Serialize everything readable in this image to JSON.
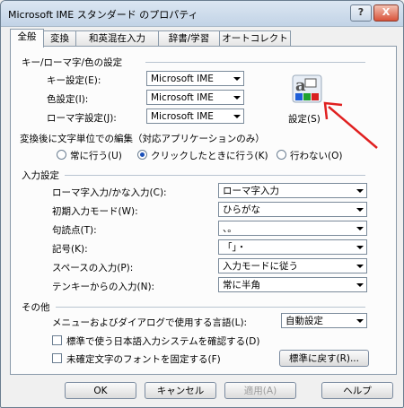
{
  "window": {
    "title": "Microsoft IME スタンダード のプロパティ",
    "help_glyph": "?",
    "close_glyph": "X"
  },
  "tabs": [
    "全般",
    "変換",
    "和英混在入力",
    "辞書/学習",
    "オートコレクト"
  ],
  "section_key": {
    "header": "キー/ローマ字/色の設定",
    "rows": [
      {
        "label": "キー設定(E):",
        "value": "Microsoft IME"
      },
      {
        "label": "色設定(I):",
        "value": "Microsoft IME"
      },
      {
        "label": "ローマ字設定(J):",
        "value": "Microsoft IME"
      }
    ],
    "settings_button": "設定(S)"
  },
  "section_conversion": {
    "header": "変換後に文字単位での編集（対応アプリケーションのみ）",
    "options": [
      {
        "label": "常に行う(U)",
        "selected": false
      },
      {
        "label": "クリックしたときに行う(K)",
        "selected": true
      },
      {
        "label": "行わない(O)",
        "selected": false
      }
    ]
  },
  "section_input": {
    "header": "入力設定",
    "rows": [
      {
        "label": "ローマ字入力/かな入力(C):",
        "value": "ローマ字入力"
      },
      {
        "label": "初期入力モード(W):",
        "value": "ひらがな"
      },
      {
        "label": "句読点(T):",
        "value": "、。"
      },
      {
        "label": "記号(K):",
        "value": "「」・"
      },
      {
        "label": "スペースの入力(P):",
        "value": "入力モードに従う"
      },
      {
        "label": "テンキーからの入力(N):",
        "value": "常に半角"
      }
    ]
  },
  "section_other": {
    "header": "その他",
    "language_label": "メニューおよびダイアログで使用する言語(L):",
    "language_value": "自動設定",
    "check1": "標準で使う日本語入力システムを確認する(D)",
    "check2": "未確定文字のフォントを固定する(F)",
    "reset_button": "標準に戻す(R)..."
  },
  "buttons": {
    "ok": "OK",
    "cancel": "キャンセル",
    "apply": "適用(A)",
    "help": "ヘルプ"
  },
  "colors": {
    "annotation_arrow": "#e02020",
    "radio_dot": "#1a4fb8"
  }
}
